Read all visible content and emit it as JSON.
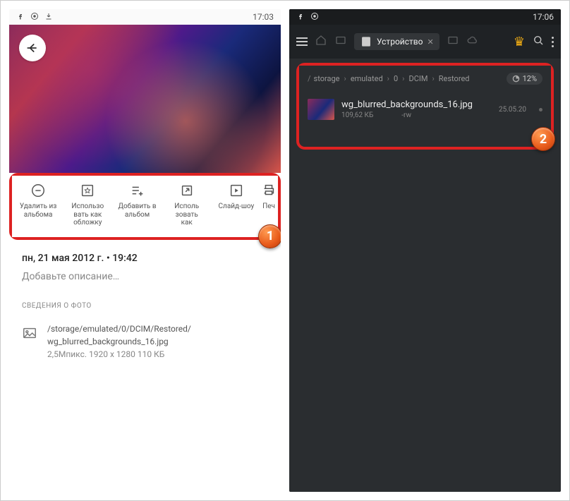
{
  "left": {
    "status_time": "17:03",
    "actions": {
      "remove": "Удалить из\nальбома",
      "cover": "Использо\nвать как\nобложку",
      "add": "Добавить в\nальбом",
      "use_as": "Исполь\nзовать\nкак",
      "slideshow": "Слайд-шоу",
      "print": "Печ"
    },
    "timestamp": "пн, 21 мая 2012 г.  •  19:42",
    "description_placeholder": "Добавьте описание…",
    "details_header": "СВЕДЕНИЯ О ФОТО",
    "file_path": "/storage/emulated/0/DCIM/Restored/",
    "file_name": "wg_blurred_backgrounds_16.jpg",
    "file_meta": "2,5Мпикс.    1920 x 1280    110 КБ",
    "badge": "1"
  },
  "right": {
    "status_time": "17:06",
    "tab_label": "Устройство",
    "crumbs": [
      "storage",
      "emulated",
      "0",
      "DCIM",
      "Restored"
    ],
    "storage_pct": "12%",
    "file_name": "wg_blurred_backgrounds_16.jpg",
    "file_size": "109,62 КБ",
    "file_perm": "-rw",
    "file_date": "25.05.20",
    "badge": "2"
  }
}
